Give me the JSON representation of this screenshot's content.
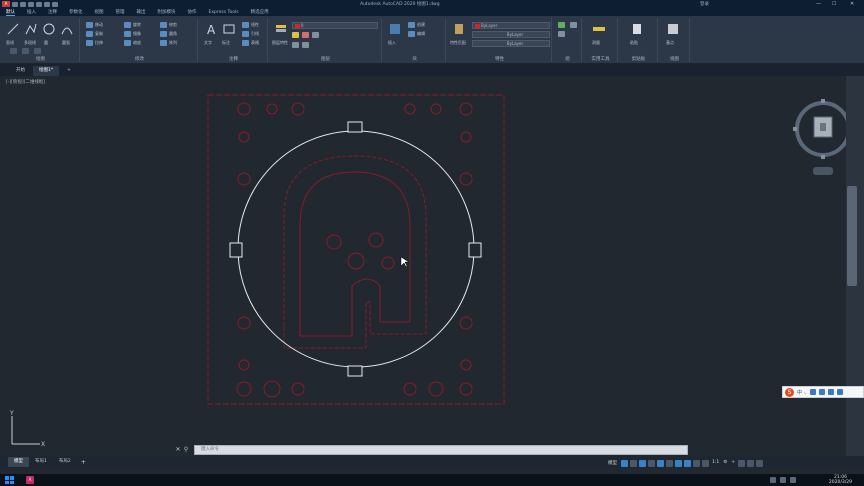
{
  "titlebar": {
    "title": "Autodesk AutoCAD 2020  绘图1.dwg",
    "user": "登录",
    "minimize": "—",
    "maximize": "☐",
    "close": "✕"
  },
  "menubar": {
    "items": [
      "默认",
      "插入",
      "注释",
      "参数化",
      "视图",
      "管理",
      "输出",
      "附加模块",
      "协作",
      "Express Tools",
      "精选应用"
    ],
    "active_index": 0
  },
  "ribbon": {
    "panels": [
      {
        "label": "绘图",
        "tools": [
          "直线",
          "多段线",
          "圆",
          "圆弧"
        ]
      },
      {
        "label": "修改",
        "tools": [
          "移动",
          "旋转",
          "修剪",
          "复制",
          "镜像",
          "圆角",
          "拉伸",
          "缩放",
          "阵列"
        ]
      },
      {
        "label": "注释",
        "tools": [
          "文字",
          "标注",
          "线性",
          "引线",
          "表格"
        ]
      },
      {
        "label": "图层",
        "tools": [
          "图层特性"
        ],
        "current_layer": "0"
      },
      {
        "label": "块",
        "tools": [
          "插入",
          "创建",
          "编辑"
        ]
      },
      {
        "label": "特性",
        "tools": [
          "特性匹配"
        ],
        "color": "ByLayer",
        "linetype": "ByLayer",
        "lineweight": "ByLayer"
      },
      {
        "label": "组",
        "tools": [
          "组"
        ]
      },
      {
        "label": "实用工具",
        "tools": [
          "测量"
        ]
      },
      {
        "label": "剪贴板",
        "tools": [
          "粘贴"
        ]
      },
      {
        "label": "视图",
        "tools": [
          "基点"
        ]
      }
    ]
  },
  "filetabs": {
    "tabs": [
      "开始",
      "绘图1*"
    ],
    "add": "+",
    "active_index": 1
  },
  "viewport": {
    "label": "[-][俯视][二维线框]",
    "crosshair_label": ""
  },
  "ime": {
    "logo": "S",
    "text": "中 ·,"
  },
  "commandline": {
    "placeholder": "键入命令",
    "close_glyph": "✕",
    "search_glyph": "⚲"
  },
  "layouttabs": {
    "tabs": [
      "模型",
      "布局1",
      "布局2"
    ],
    "add": "+",
    "active_index": 0
  },
  "statusbar": {
    "model_label": "模型",
    "scale": "1:1",
    "gear": "⚙",
    "plus": "+"
  },
  "taskbar": {
    "time": "21:06",
    "date": "2020/3/29"
  },
  "colors": {
    "drawing_red": "#8b1a2a",
    "drawing_white": "#e8eaee",
    "background": "#212830"
  },
  "icons": [
    "search-icon",
    "gear-icon",
    "close-icon",
    "windows-icon",
    "layer-icon"
  ]
}
